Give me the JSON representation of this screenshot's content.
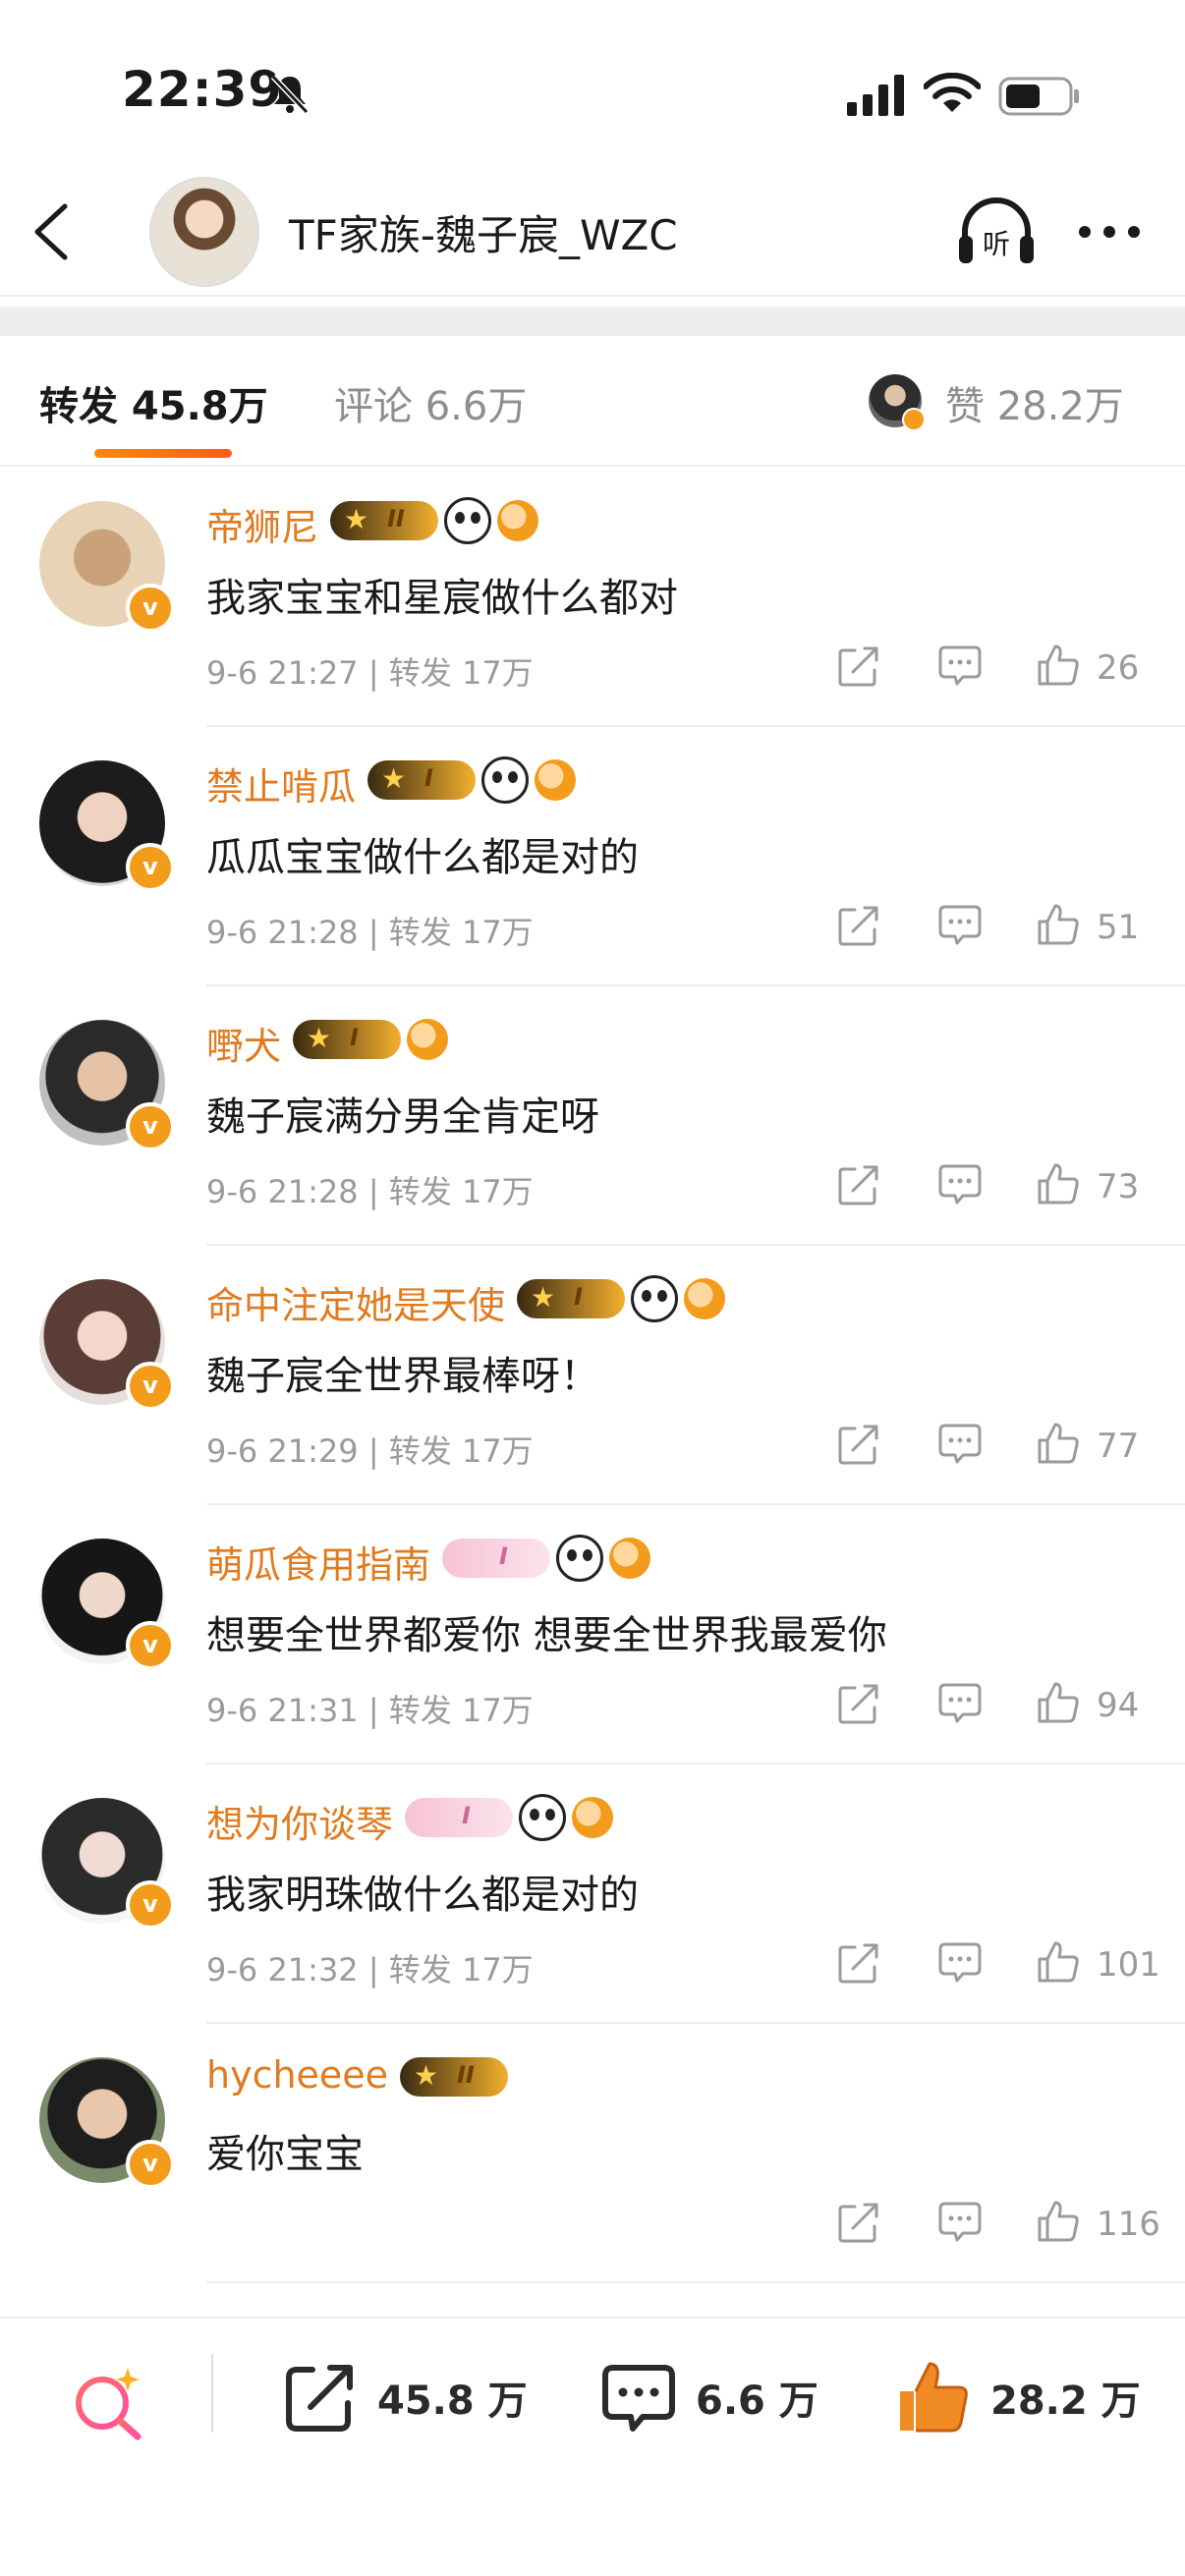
{
  "status_bar": {
    "time": "22:39"
  },
  "header": {
    "title": "TF家族-魏子宸_WZC",
    "listen_label": "听"
  },
  "tabs": {
    "repost": "转发 45.8万",
    "comment": "评论 6.6万",
    "likes": "赞 28.2万"
  },
  "rows": [
    {
      "name": "帝狮尼",
      "level": "II",
      "badge": "crown",
      "panda": true,
      "text": "我家宝宝和星宸做什么都对",
      "meta": "9-6 21:27 | 转发 17万",
      "likes": "26"
    },
    {
      "name": "禁止啃瓜",
      "level": "I",
      "badge": "crown",
      "panda": true,
      "text": "瓜瓜宝宝做什么都是对的",
      "meta": "9-6 21:28 | 转发 17万",
      "likes": "51"
    },
    {
      "name": "嘢犬",
      "level": "I",
      "badge": "crown",
      "panda": false,
      "text": "魏子宸满分男全肯定呀",
      "meta": "9-6 21:28 | 转发 17万",
      "likes": "73"
    },
    {
      "name": "命中注定她是天使",
      "level": "I",
      "badge": "crown",
      "panda": true,
      "text": "魏子宸全世界最棒呀！",
      "meta": "9-6 21:29 | 转发 17万",
      "likes": "77"
    },
    {
      "name": "萌瓜食用指南",
      "level": "I",
      "badge": "pink",
      "panda": true,
      "text": "想要全世界都爱你 想要全世界我最爱你",
      "meta": "9-6 21:31 | 转发 17万",
      "likes": "94"
    },
    {
      "name": "想为你谈琴",
      "level": "I",
      "badge": "pink",
      "panda": true,
      "text": "我家明珠做什么都是对的",
      "meta": "9-6 21:32 | 转发 17万",
      "likes": "101"
    },
    {
      "name": "hycheeee",
      "level": "II",
      "badge": "crown",
      "panda": false,
      "text": "爱你宝宝",
      "meta": "",
      "likes": "116"
    }
  ],
  "bottom_bar": {
    "repost_count": "45.8 万",
    "comment_count": "6.6 万",
    "like_count": "28.2 万"
  },
  "colors": {
    "accent": "#e07b1f",
    "like_orange": "#f08a24",
    "badge_v": "#f39b1a"
  }
}
